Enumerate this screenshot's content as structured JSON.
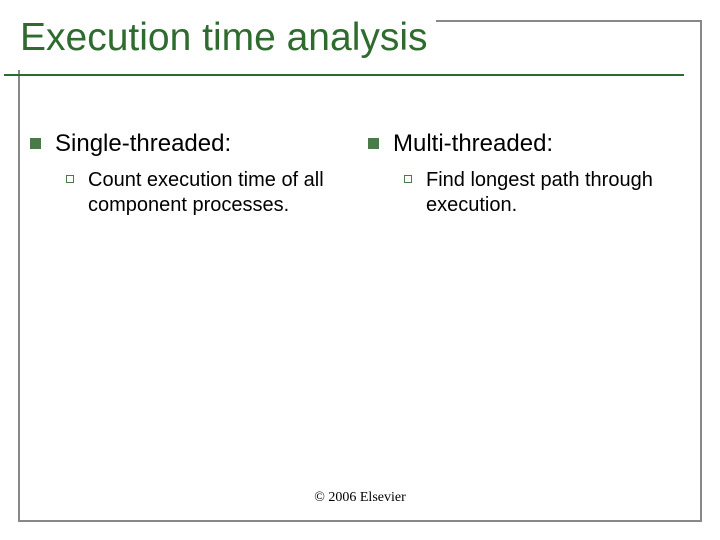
{
  "title": "Execution time analysis",
  "columns": {
    "left": {
      "heading": "Single-threaded:",
      "sub": "Count execution time of all component processes."
    },
    "right": {
      "heading": "Multi-threaded:",
      "sub": "Find longest path through execution."
    }
  },
  "footer": "© 2006 Elsevier"
}
